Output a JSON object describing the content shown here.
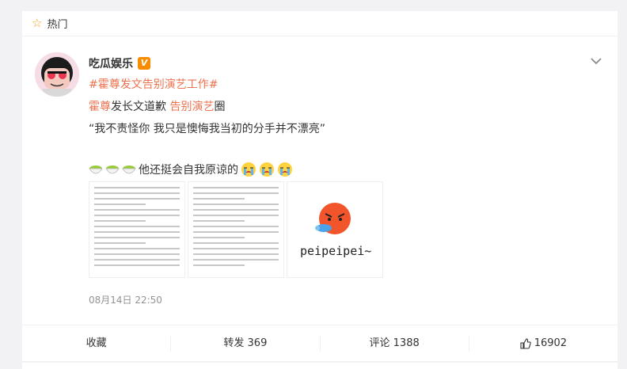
{
  "hot_bar": {
    "label": "热门"
  },
  "post": {
    "username": "吃瓜娱乐",
    "hashtag": "#霍尊发文告别演艺工作#",
    "line2_prefix": "霍尊",
    "line2_middle": "发长文道歉 ",
    "line2_link": "告别演艺",
    "line2_suffix": "圈",
    "line3": "“我不责怪你 我只是懊悔我当初的分手并不漂亮”",
    "line4": "他还挺会自我原谅的",
    "image3_caption": "peipeipei~",
    "timestamp": "08月14日 22:50"
  },
  "actions": {
    "favorite": "收藏",
    "repost": "转发 369",
    "comment": "评论 1388",
    "like": "16902"
  },
  "colors": {
    "link": "#eb7350",
    "hot_star": "#f0a020",
    "verified": "#f78c00"
  },
  "icons": [
    "star-icon",
    "verified-icon",
    "chevron-down-icon",
    "bowl-emoji-icon",
    "crying-emoji-icon",
    "thumbs-up-icon"
  ]
}
